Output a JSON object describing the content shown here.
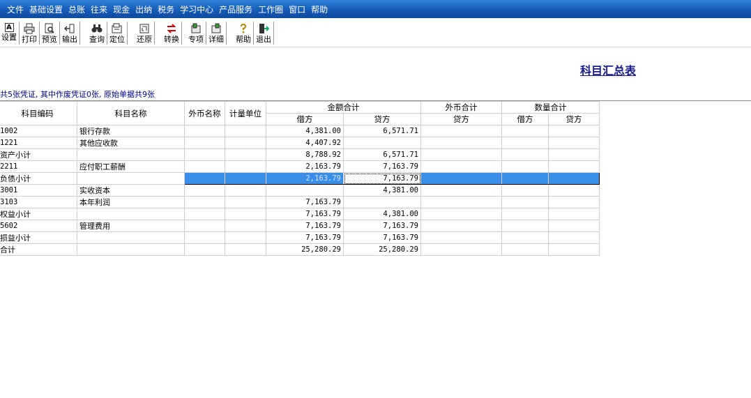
{
  "menu": [
    "文件",
    "基础设置",
    "总账",
    "往来",
    "现金",
    "出纳",
    "税务",
    "学习中心",
    "产品服务",
    "工作圈",
    "窗口",
    "帮助"
  ],
  "toolbar": {
    "setup": {
      "label": "设置",
      "icon": "A"
    },
    "print": {
      "label": "打印",
      "icon": "🖶"
    },
    "preview": {
      "label": "预览",
      "icon": "🔍"
    },
    "export": {
      "label": "输出",
      "icon": "↤"
    },
    "query": {
      "label": "查询",
      "icon": "🔭"
    },
    "locate": {
      "label": "定位",
      "icon": "⊡"
    },
    "restore": {
      "label": "还原",
      "icon": "↻"
    },
    "convert": {
      "label": "转换",
      "icon": "⇄"
    },
    "special": {
      "label": "专项",
      "icon": "▣"
    },
    "detail": {
      "label": "详细",
      "icon": "☰"
    },
    "help": {
      "label": "帮助",
      "icon": "?"
    },
    "exit": {
      "label": "退出",
      "icon": "⇥"
    }
  },
  "report": {
    "title": "科目汇总表",
    "summary": "共5张凭证, 其中作废凭证0张, 原始单据共9张"
  },
  "table": {
    "headers": {
      "code": "科目编码",
      "name": "科目名称",
      "currency_name": "外币名称",
      "unit": "计量单位",
      "amount_total": "金额合计",
      "fx_total": "外币合计",
      "qty_total": "数量合计",
      "debit": "借方",
      "credit": "贷方"
    },
    "rows": [
      {
        "code": "1002",
        "name": "银行存款",
        "cur": "",
        "unit": "",
        "debit": "4,381.00",
        "credit": "6,571.71",
        "fx_credit": "",
        "qty_debit": "",
        "qty_credit": ""
      },
      {
        "code": "1221",
        "name": "其他应收款",
        "cur": "",
        "unit": "",
        "debit": "4,407.92",
        "credit": "",
        "fx_credit": "",
        "qty_debit": "",
        "qty_credit": ""
      },
      {
        "code": "资产小计",
        "name": "",
        "cur": "",
        "unit": "",
        "debit": "8,788.92",
        "credit": "6,571.71",
        "fx_credit": "",
        "qty_debit": "",
        "qty_credit": ""
      },
      {
        "code": "2211",
        "name": "应付职工薪酬",
        "cur": "",
        "unit": "",
        "debit": "2,163.79",
        "credit": "7,163.79",
        "fx_credit": "",
        "qty_debit": "",
        "qty_credit": ""
      },
      {
        "code": "负债小计",
        "name": "",
        "cur": "",
        "unit": "",
        "debit": "2,163.79",
        "credit": "7,163.79",
        "fx_credit": "",
        "qty_debit": "",
        "qty_credit": ""
      },
      {
        "code": "3001",
        "name": "实收资本",
        "cur": "",
        "unit": "",
        "debit": "",
        "credit": "4,381.00",
        "fx_credit": "",
        "qty_debit": "",
        "qty_credit": ""
      },
      {
        "code": "3103",
        "name": "本年利润",
        "cur": "",
        "unit": "",
        "debit": "7,163.79",
        "credit": "",
        "fx_credit": "",
        "qty_debit": "",
        "qty_credit": ""
      },
      {
        "code": "权益小计",
        "name": "",
        "cur": "",
        "unit": "",
        "debit": "7,163.79",
        "credit": "4,381.00",
        "fx_credit": "",
        "qty_debit": "",
        "qty_credit": ""
      },
      {
        "code": "5602",
        "name": "管理费用",
        "cur": "",
        "unit": "",
        "debit": "7,163.79",
        "credit": "7,163.79",
        "fx_credit": "",
        "qty_debit": "",
        "qty_credit": ""
      },
      {
        "code": "损益小计",
        "name": "",
        "cur": "",
        "unit": "",
        "debit": "7,163.79",
        "credit": "7,163.79",
        "fx_credit": "",
        "qty_debit": "",
        "qty_credit": ""
      },
      {
        "code": "合计",
        "name": "",
        "cur": "",
        "unit": "",
        "debit": "25,280.29",
        "credit": "25,280.29",
        "fx_credit": "",
        "qty_debit": "",
        "qty_credit": ""
      }
    ]
  }
}
